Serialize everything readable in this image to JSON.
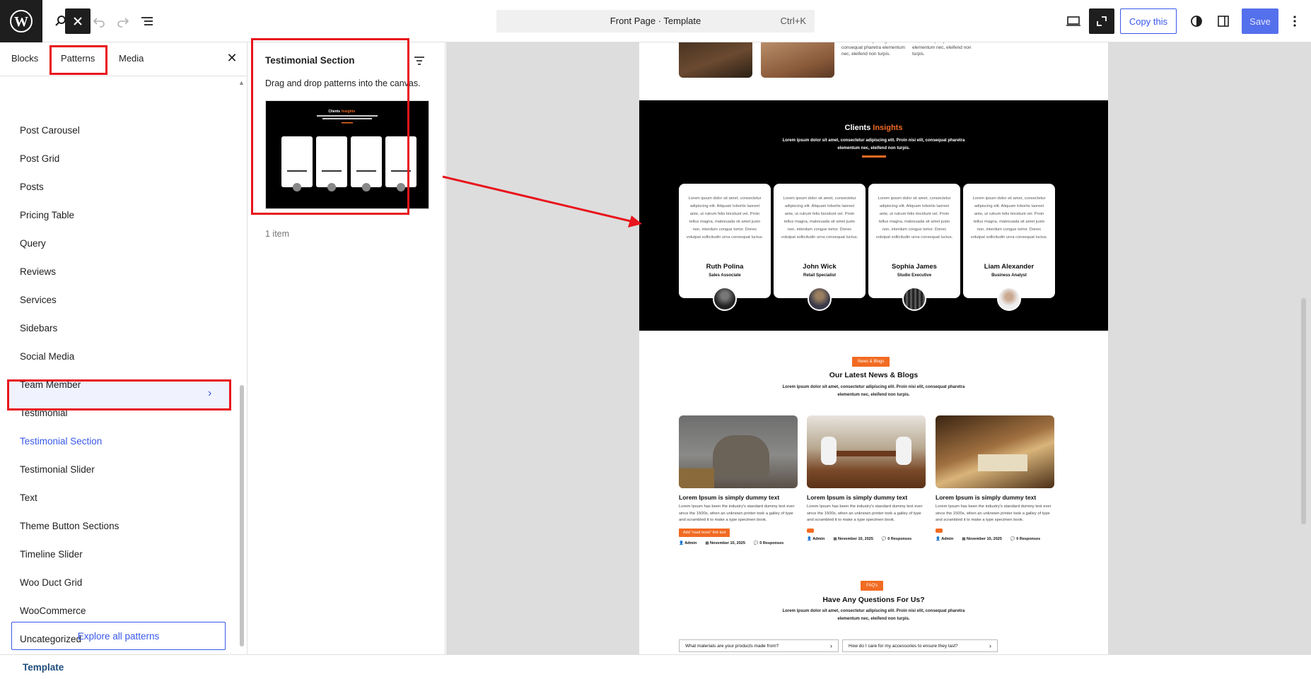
{
  "topbar": {
    "command_title": "Front Page · Template",
    "command_shortcut": "Ctrl+K",
    "copy_label": "Copy this",
    "save_label": "Save"
  },
  "inserter": {
    "tabs": [
      "Blocks",
      "Patterns",
      "Media"
    ],
    "categories": [
      "Post Carousel",
      "Post Grid",
      "Posts",
      "Pricing Table",
      "Query",
      "Reviews",
      "Services",
      "Sidebars",
      "Social Media",
      "Team Member",
      "Testimonial",
      "Testimonial Section",
      "Testimonial Slider",
      "Text",
      "Theme Button Sections",
      "Timeline Slider",
      "Woo Duct Grid",
      "WooCommerce",
      "Uncategorized"
    ],
    "selected_category": "Testimonial Section",
    "explore_label": "Explore all patterns"
  },
  "patterns_panel": {
    "title": "Testimonial Section",
    "description": "Drag and drop patterns into the canvas.",
    "count": "1 item"
  },
  "page": {
    "top_text_1": "consectetur adipiscing elit. consequat pharetra elementum nec, eleifend non turpis.",
    "top_text_2": "elit, consequat pharetra elementum nec, eleifend non turpis.",
    "testimonials": {
      "title_a": "Clients",
      "title_b": "Insights",
      "subtitle": "Lorem ipsum dolor sit amet, consectetur adipiscing elit. Proin nisi elit, consequat pharetra elementum nec, eleifend non turpis.",
      "card_text": "Lorem ipsum dolor sit amet, consectetur adipiscing elit. Aliquam lobortis laoreet ante, ut rutrum felis tincidunt vel. Proin tellus magna, malesuada sit amet justo non, interdum congue tortor. Donec volutpat sollicitudin urna consequat luctus.",
      "people": [
        {
          "name": "Ruth Polina",
          "role": "Sales Associate"
        },
        {
          "name": "John Wick",
          "role": "Retail Specialist"
        },
        {
          "name": "Sophia James",
          "role": "Studio Executive"
        },
        {
          "name": "Liam Alexander",
          "role": "Business Analyst"
        }
      ]
    },
    "news": {
      "badge": "News & Blogs",
      "title": "Our Latest News & Blogs",
      "subtitle": "Lorem ipsum dolor sit amet, consectetur adipiscing elit. Proin nisi elit, consequat pharetra elementum nec, eleifend non turpis.",
      "post_title": "Lorem Ipsum is simply dummy text",
      "post_text": "Lorem Ipsum has been the industry's standard dummy text ever since the 1500s, when an unknown printer took a galley of type and scrambled it to make a type specimen book.",
      "read_more": "Add \"read more\" link text",
      "author": "Admin",
      "date": "November 10, 2025",
      "responses": "0 Responses"
    },
    "faq": {
      "badge": "FAQ's",
      "title": "Have Any Questions For Us?",
      "subtitle": "Lorem ipsum dolor sit amet, consectetur adipiscing elit. Proin nisi elit, consequat pharetra elementum nec, eleifend non turpis.",
      "q1": "What materials are your products made from?",
      "q2": "How do I care for my accessories to ensure they last?"
    },
    "thumb_title_a": "Clients",
    "thumb_title_b": "Insights"
  },
  "bottombar": {
    "breadcrumb": "Template"
  },
  "colors": {
    "accent": "#3858e9",
    "highlight_red": "#e8141b",
    "brand_orange": "#f26b22"
  }
}
